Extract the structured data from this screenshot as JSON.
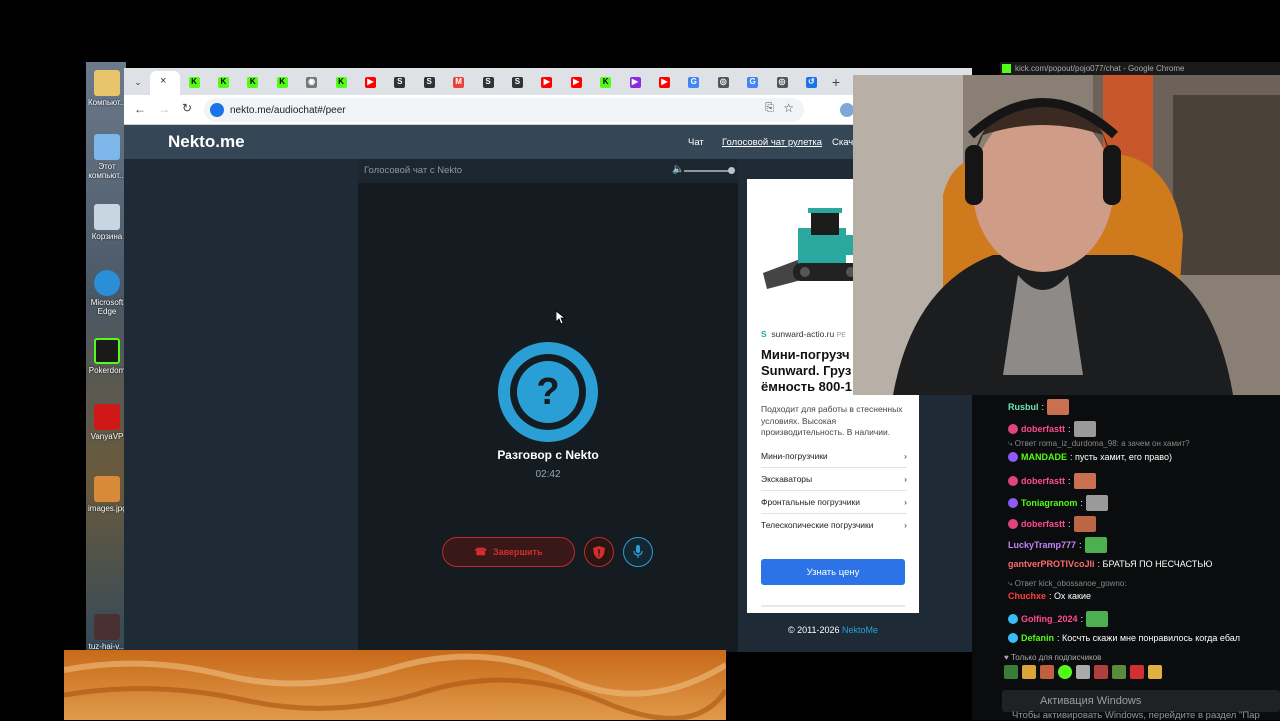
{
  "desktop": {
    "icons": [
      "Компьют...",
      "Этот компьют...",
      "Корзина",
      "Microsoft Edge",
      "Pokerdom",
      "VanyaVP",
      "images.jpg",
      "tuz-hai-v..."
    ]
  },
  "browser": {
    "url": "nekto.me/audiochat#/peer",
    "tab_icons": [
      "kick",
      "kick",
      "kick",
      "kick",
      "web",
      "kick",
      "youtube",
      "shorts",
      "shorts",
      "gmail",
      "shorts",
      "shorts",
      "youtube",
      "youtube",
      "kick",
      "player",
      "youtube",
      "google",
      "chrome",
      "google",
      "chrome",
      "history"
    ],
    "new_tab_label": "+"
  },
  "nekto": {
    "logo": "Nekto.me",
    "nav": [
      "Чат",
      "Голосовой чат рулетка",
      "Скача"
    ],
    "chat_bar_label": "Голосовой чат с Nekto",
    "avatar_glyph": "?",
    "talk_title": "Разговор с Nekto",
    "talk_time": "02:42",
    "end_button": "Завершить",
    "copyright_prefix": "© 2011-2026 ",
    "copyright_link": "NektoMe"
  },
  "ad": {
    "domain": "sunward-actio.ru",
    "domain_suffix": "РЕ",
    "title": "Мини-погрузч\nSunward. Груз\nёмность 800-1",
    "description": "Подходит для работы в стесненных условиях. Высокая производительность. В наличии.",
    "items": [
      "Мини-погрузчики",
      "Экскаваторы",
      "Фронтальные погрузчики",
      "Телескопические погрузчики"
    ],
    "button": "Узнать цену"
  },
  "kick": {
    "window_title": "kick.com/popout/pojo077/chat - Google Chrome",
    "messages": [
      {
        "user": "Rusbul",
        "color": "#6ee7b7",
        "text": "",
        "emote": true,
        "badge": ""
      },
      {
        "user": "doberfastt",
        "color": "#ff4d8d",
        "text": "",
        "emote": true,
        "badge": "#e0447c"
      },
      {
        "reply": "Ответ roma_iz_durdoma_98: а зачем он хамит?"
      },
      {
        "user": "MANDADE",
        "color": "#53fc18",
        "text": ": пусть хамит, его право)",
        "emote": false,
        "badge": "#8b5cf6"
      },
      {
        "user": "doberfastt",
        "color": "#ff4d8d",
        "text": "",
        "emote": true,
        "badge": "#e0447c"
      },
      {
        "user": "Toniagranom",
        "color": "#53fc18",
        "text": "",
        "emote": true,
        "badge": "#8b5cf6"
      },
      {
        "user": "doberfastt",
        "color": "#ff4d8d",
        "text": "",
        "emote": true,
        "badge": "#e0447c"
      },
      {
        "user": "LuckyTramp777",
        "color": "#c084fc",
        "text": "",
        "emote": true,
        "badge": ""
      },
      {
        "user": "gantverPROTIVcoJli",
        "color": "#ff6b6b",
        "text": ": БРАТЬЯ ПО НЕСЧАСТЬЮ",
        "emote": false,
        "badge": ""
      },
      {
        "reply": "Ответ kick_obossanoe_gowno:"
      },
      {
        "user": "Chuchxe",
        "color": "#ff4040",
        "text": ": Ох какие",
        "emote": false,
        "badge": ""
      },
      {
        "user": "Golfing_2024",
        "color": "#ff4d8d",
        "text": "",
        "emote": true,
        "badge": "#38bdf8"
      },
      {
        "user": "Defanin",
        "color": "#53fc18",
        "text": ": Косчть скажи мне понравилось когда ебал",
        "emote": false,
        "badge": "#38bdf8"
      }
    ],
    "subs_only": "Только для подписчиков"
  },
  "windows": {
    "activate_title": "Активация Windows",
    "activate_sub": "Чтобы активировать Windows, перейдите в раздел \"Пар"
  },
  "colors": {
    "nekto_blue": "#2a9fd6",
    "end_red": "#d42f2c",
    "kick_green": "#53fc18",
    "ad_button": "#2d73e8"
  }
}
